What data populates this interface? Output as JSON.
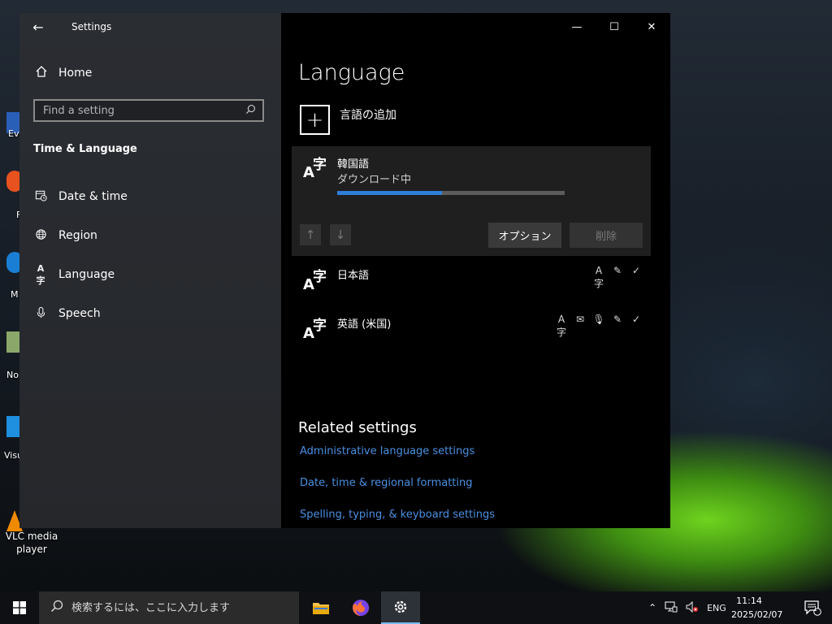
{
  "desktop": {
    "vlc_label_line1": "VLC media",
    "vlc_label_line2": "player",
    "partial_labels": [
      "Eve",
      "F",
      "M",
      "No",
      "Visu"
    ]
  },
  "window": {
    "app_title": "Settings",
    "controls": {
      "minimize": "—",
      "maximize": "☐",
      "close": "✕"
    }
  },
  "sidebar": {
    "home_label": "Home",
    "search_placeholder": "Find a setting",
    "section_title": "Time & Language",
    "items": [
      {
        "label": "Date & time",
        "icon": "calendar-clock-icon"
      },
      {
        "label": "Region",
        "icon": "globe-icon"
      },
      {
        "label": "Language",
        "icon": "language-icon"
      },
      {
        "label": "Speech",
        "icon": "microphone-icon"
      }
    ]
  },
  "main": {
    "title": "Language",
    "add_language_label": "言語の追加",
    "languages": [
      {
        "name": "韓国語",
        "status": "ダウンロード中",
        "progress": 0.46
      },
      {
        "name": "日本語"
      },
      {
        "name": "英語 (米国)"
      }
    ],
    "options_label": "オプション",
    "remove_label": "削除",
    "related_title": "Related settings",
    "links": [
      "Administrative language settings",
      "Date, time & regional formatting",
      "Spelling, typing, & keyboard settings"
    ]
  },
  "taskbar": {
    "search_placeholder": "検索するには、ここに入力します",
    "language_indicator": "ENG",
    "time": "11:14",
    "date": "2025/02/07",
    "notification_count": "1"
  },
  "colors": {
    "accent": "#2e7fd8",
    "link": "#4a90e2",
    "sidebar_bg": "#2a2d32",
    "main_bg": "#000000"
  }
}
